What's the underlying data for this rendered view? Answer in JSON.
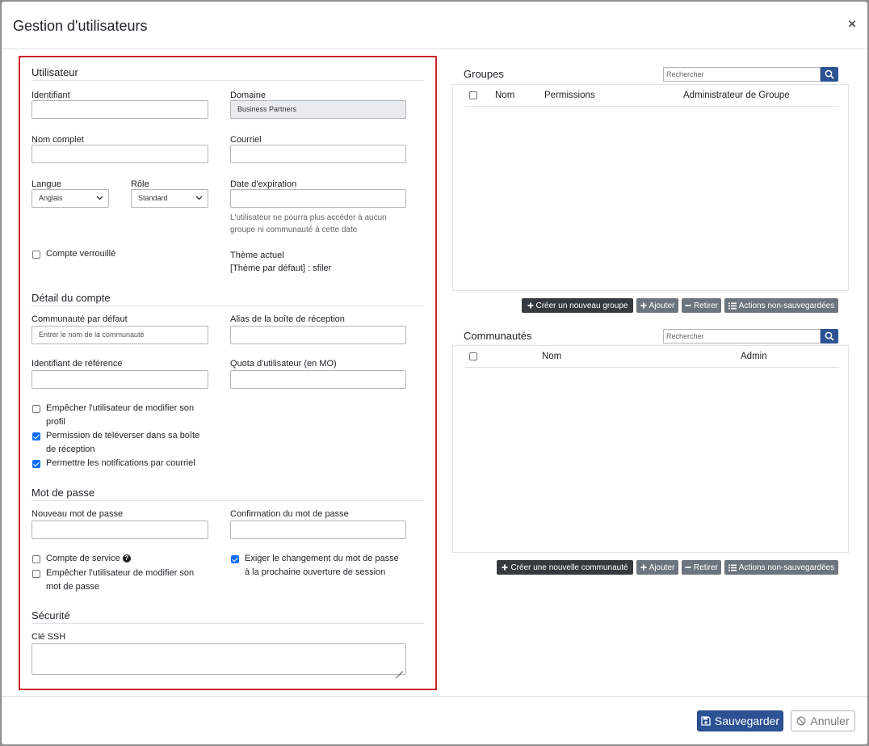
{
  "modal": {
    "title": "Gestion d'utilisateurs",
    "close_symbol": "×",
    "save_label": "Sauvegarder",
    "cancel_label": "Annuler"
  },
  "user": {
    "section": "Utilisateur",
    "identifier_label": "Identifiant",
    "identifier_value": "",
    "domain_label": "Domaine",
    "domain_value": "Business Partners",
    "fullname_label": "Nom complet",
    "email_label": "Courriel",
    "language_label": "Langue",
    "language_value": "Anglais",
    "role_label": "Rôle",
    "role_value": "Standard",
    "expiration_label": "Date d'expiration",
    "expiration_help_1": "L'utilisateur ne pourra plus accéder à aucun",
    "expiration_help_2": "groupe ni communauté à cette date",
    "locked_label": "Compte verrouillé",
    "locked_checked": false,
    "theme_label": "Thème actuel",
    "theme_value": "[Thème par défaut] : sfiler"
  },
  "account": {
    "section": "Détail du compte",
    "default_community_label": "Communauté par défaut",
    "default_community_placeholder": "Entrer le nom de la communauté",
    "inbox_alias_label": "Alias de la boîte de réception",
    "reference_id_label": "Identifiant de référence",
    "quota_label": "Quota d'utilisateur (en MO)",
    "prevent_profile_1": "Empêcher l'utilisateur de modifier son",
    "prevent_profile_2": "profil",
    "prevent_profile_checked": false,
    "upload_perm_1": "Permission de téléverser dans sa boîte",
    "upload_perm_2": "de réception",
    "upload_perm_checked": true,
    "email_notif": "Permettre les notifications par courriel",
    "email_notif_checked": true
  },
  "password": {
    "section": "Mot de passe",
    "new_label": "Nouveau mot de passe",
    "confirm_label": "Confirmation du mot de passe",
    "service_account": "Compte de service",
    "service_account_checked": false,
    "prevent_pwd_1": "Empêcher l'utilisateur de modifier son",
    "prevent_pwd_2": "mot de passe",
    "prevent_pwd_checked": false,
    "require_change_1": "Exiger le changement du mot de passe",
    "require_change_2": "à la prochaine ouverture de session",
    "require_change_checked": true
  },
  "security": {
    "section": "Sécurité",
    "ssh_label": "Clé SSH"
  },
  "groups": {
    "title": "Groupes",
    "search_placeholder": "Rechercher",
    "col_name": "Nom",
    "col_permissions": "Permissions",
    "col_admin": "Administrateur de Groupe",
    "btn_create": "Créer un nouveau groupe",
    "btn_add": "Ajouter",
    "btn_remove": "Retirer",
    "btn_unsaved": "Actions non-sauvegardées"
  },
  "communities": {
    "title": "Communautés",
    "search_placeholder": "Rechercher",
    "col_name": "Nom",
    "col_admin": "Admin",
    "btn_create": "Créer une nouvelle communauté",
    "btn_add": "Ajouter",
    "btn_remove": "Retirer",
    "btn_unsaved": "Actions non-sauvegardées"
  },
  "colors": {
    "primary": "#2c5294",
    "highlight_border": "#c8202f",
    "checkbox_on": "#0d6efd"
  }
}
